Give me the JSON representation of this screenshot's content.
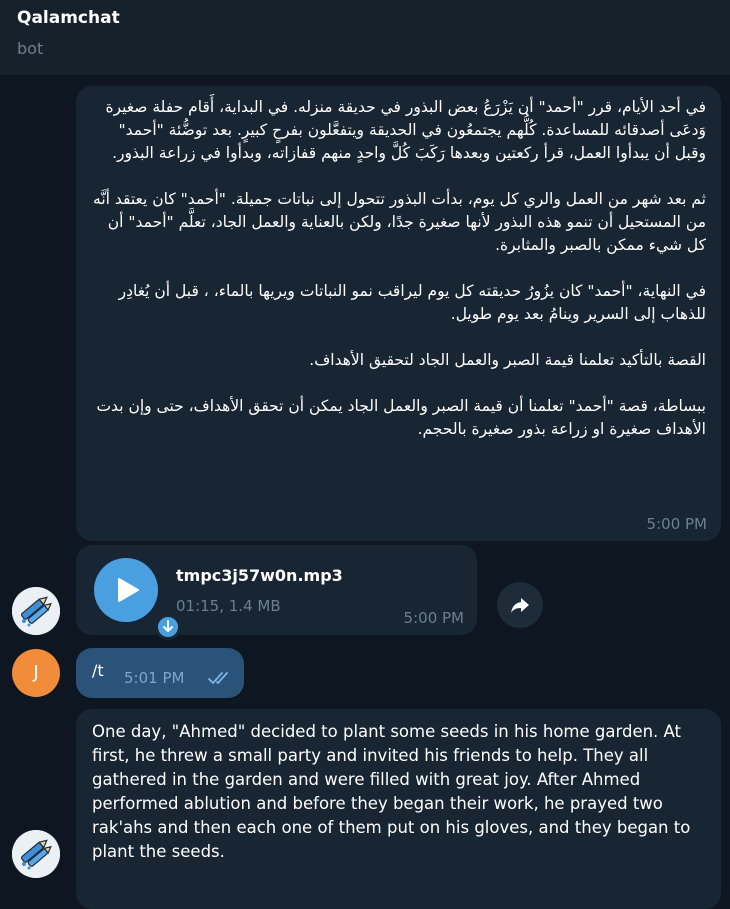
{
  "header": {
    "title": "Qalamchat",
    "subtitle": "bot"
  },
  "messages": {
    "arabic": {
      "paragraphs": [
        "في أحد الأيام، قرر \"أحمد\" أن يَزْرَعُ بعض البذور في حديقة منزله. في البداية، أَقام حفلة صغيرة وَدعَى أصدقائه للمساعدة. كُلُّهم يجتمعُون في الحديقة ويتفعَّلون بفرحٍ كبيرٍ. بعد توضُّئة \"أحمد\" وقبل أن يبدأوا العمل، قرأ ركعتين وبعدها رَكَبَ كُلَّ واحدٍ منهم قفازاته، وبدأوا في زراعة البذور.",
        "ثم بعد شهر من العمل والري كل يوم، بدأت البذور تتحول إلى نباتات جميلة. \"أحمد\" كان يعتقد أنَّه من المستحيل أن تنمو هذه البذور لأنها صغيرة جدًا، ولكن بالعناية والعمل الجاد، تعلَّم \"أحمد\" أن كل شيء ممكن بالصبر والمثابرة.",
        "في النهاية، \"أحمد\" كان يزُورُ حديقته كل يوم ليراقب نمو النباتات ويريها بالماء، ، قبل أن يُغادِر للذهاب إلى السرير وينامُ بعد يوم طويل.",
        "القصة بالتأكيد تعلمنا قيمة الصبر والعمل الجاد لتحقيق الأهداف.",
        "ببساطة، قصة \"أحمد\" تعلمنا أن قيمة الصبر والعمل الجاد يمكن أن تحقق الأهداف، حتى وإن بدت الأهداف صغيرة او زراعة بذور صغيرة بالحجم."
      ],
      "time": "5:00 PM"
    },
    "audio": {
      "file_name": "tmpc3j57w0n.mp3",
      "meta": "01:15, 1.4 MB",
      "time": "5:00 PM"
    },
    "outgoing": {
      "text": "/t",
      "time": "5:01 PM"
    },
    "english": {
      "text": "One day, \"Ahmed\" decided to plant some seeds in his home garden. At first, he threw a small party and invited his friends to help. They all gathered in the garden and were filled with great joy. After Ahmed performed ablution and before they began their work, he prayed two rak'ahs and then each one of them put on his gloves, and they began to plant the seeds."
    }
  },
  "avatars": {
    "user_initial": "J"
  },
  "colors": {
    "background": "#0e1621",
    "header": "#17212b",
    "incoming_bubble": "#182533",
    "outgoing_bubble": "#2b5278",
    "accent": "#4a9fe0",
    "muted": "#6d7f8f",
    "user_avatar": "#f08c3a"
  },
  "icons": {
    "play": "play-icon",
    "download": "download-arrow-icon",
    "forward": "forward-arrow-icon",
    "read_receipt": "double-check-icon",
    "bot_avatar": "pen-avatar-icon"
  }
}
